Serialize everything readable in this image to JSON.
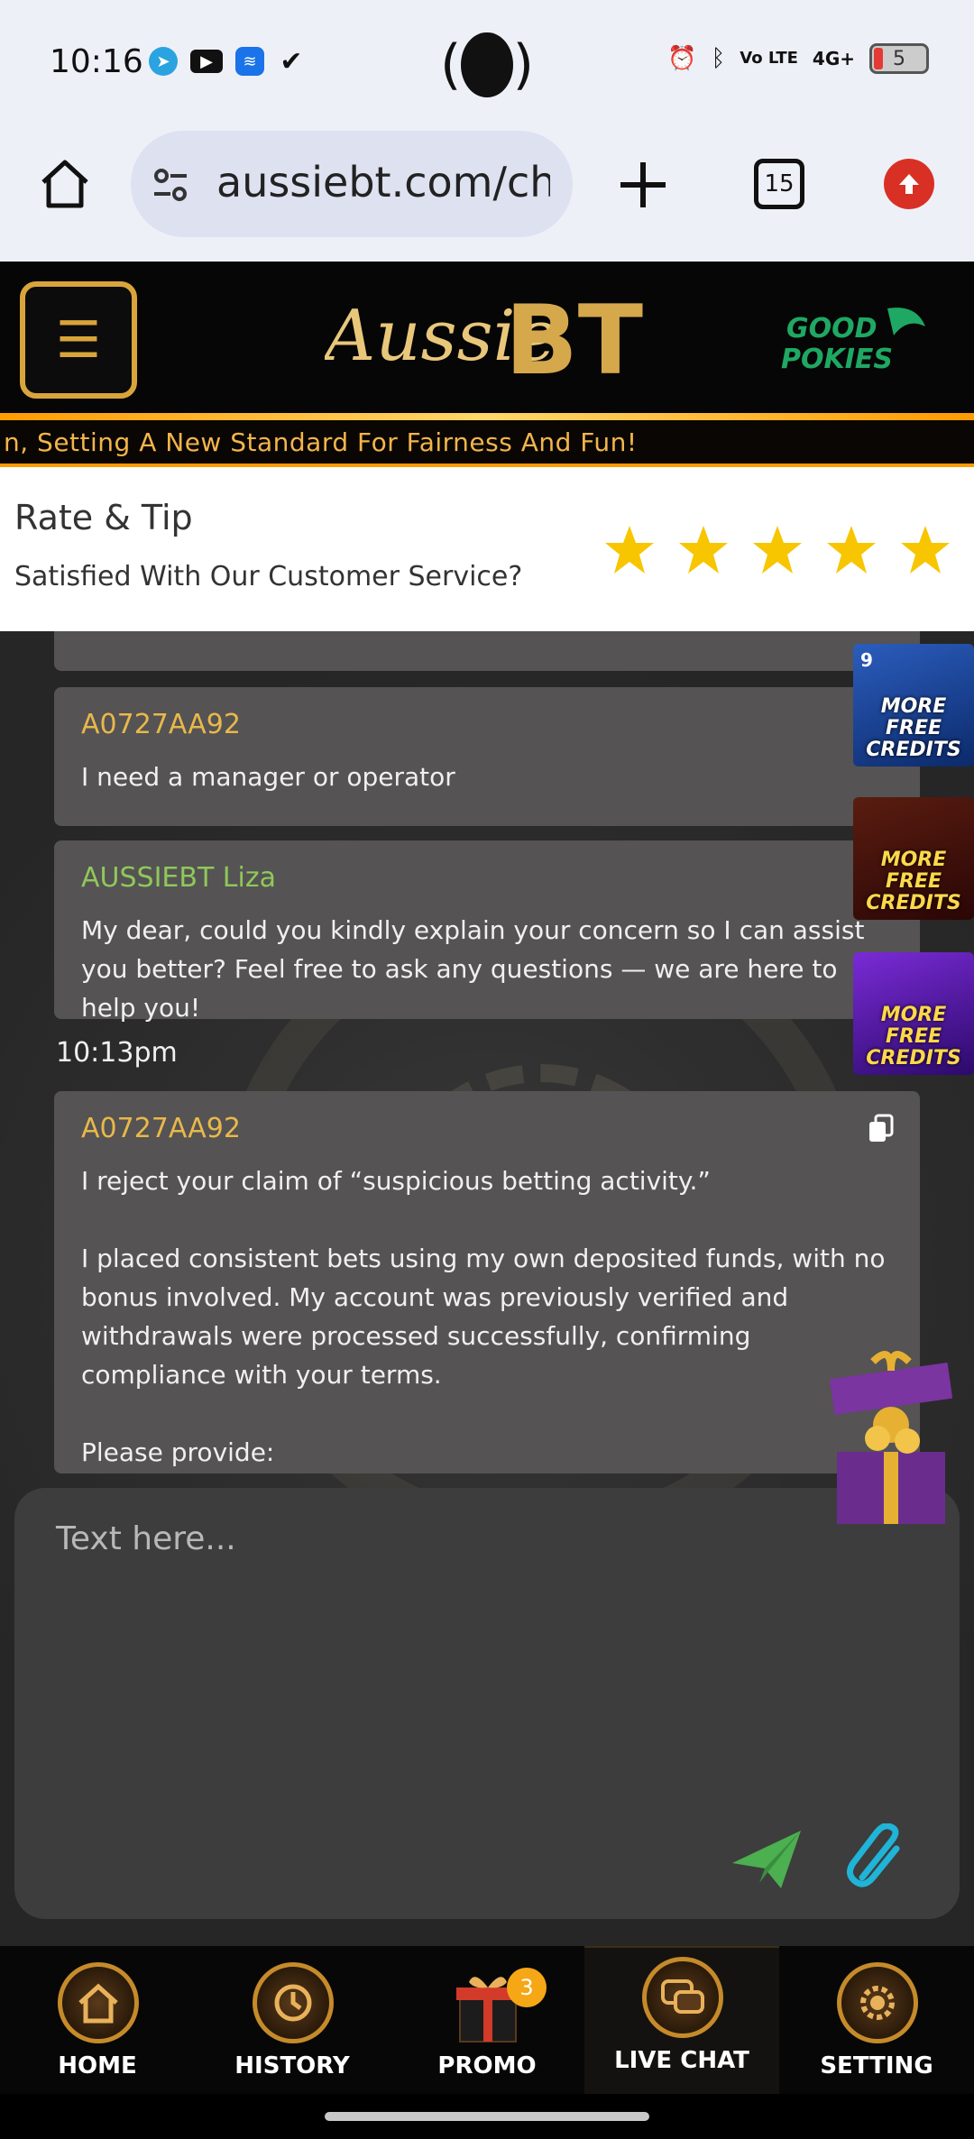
{
  "status_bar": {
    "time": "10:16",
    "battery": "5",
    "network": "4G+",
    "volte": "Vo LTE"
  },
  "browser": {
    "url": "aussiebt.com/cha",
    "tab_count": "15"
  },
  "site": {
    "logo_text": "AussieBT",
    "partner_text": "GOOD POKIES",
    "ticker": "n, Setting A New Standard For Fairness And Fun!"
  },
  "rating": {
    "title": "Rate & Tip",
    "subtitle": "Satisfied With Our Customer Service?",
    "stars": 5,
    "star_color": "#f7c600"
  },
  "messages": [
    {
      "sender": "A0727AA92",
      "role": "user",
      "text": "I need a manager or operator"
    },
    {
      "sender": "AUSSIEBT Liza",
      "role": "agent",
      "text": "My dear, could you kindly explain your concern so I can assist you better? Feel free to ask any questions — we are here to help you!"
    },
    {
      "timestamp": "10:13pm"
    },
    {
      "sender": "A0727AA92",
      "role": "user",
      "text": "I reject your claim of “suspicious betting activity.”\n\nI placed consistent bets using my own deposited funds, with no bonus involved. My account was previously verified and withdrawals were processed successfully, confirming compliance with your terms.\n\nPlease provide:"
    }
  ],
  "side_promos": [
    {
      "label": "MORE FREE CREDITS",
      "badge": "9"
    },
    {
      "label": "MORE FREE CREDITS"
    },
    {
      "label": "MORE FREE CREDITS"
    }
  ],
  "input": {
    "placeholder": "Text here..."
  },
  "bottom_nav": [
    {
      "label": "HOME",
      "icon": "home-icon"
    },
    {
      "label": "HISTORY",
      "icon": "history-icon"
    },
    {
      "label": "PROMO",
      "icon": "gift-icon",
      "badge": "3"
    },
    {
      "label": "LIVE CHAT",
      "icon": "chat-icon",
      "active": true
    },
    {
      "label": "SETTING",
      "icon": "gear-icon"
    }
  ],
  "colors": {
    "gold": "#d9a53a",
    "user_name": "#e8b84a",
    "agent_name": "#8fc85a",
    "send": "#4caf50",
    "attach": "#1fb4d8"
  }
}
